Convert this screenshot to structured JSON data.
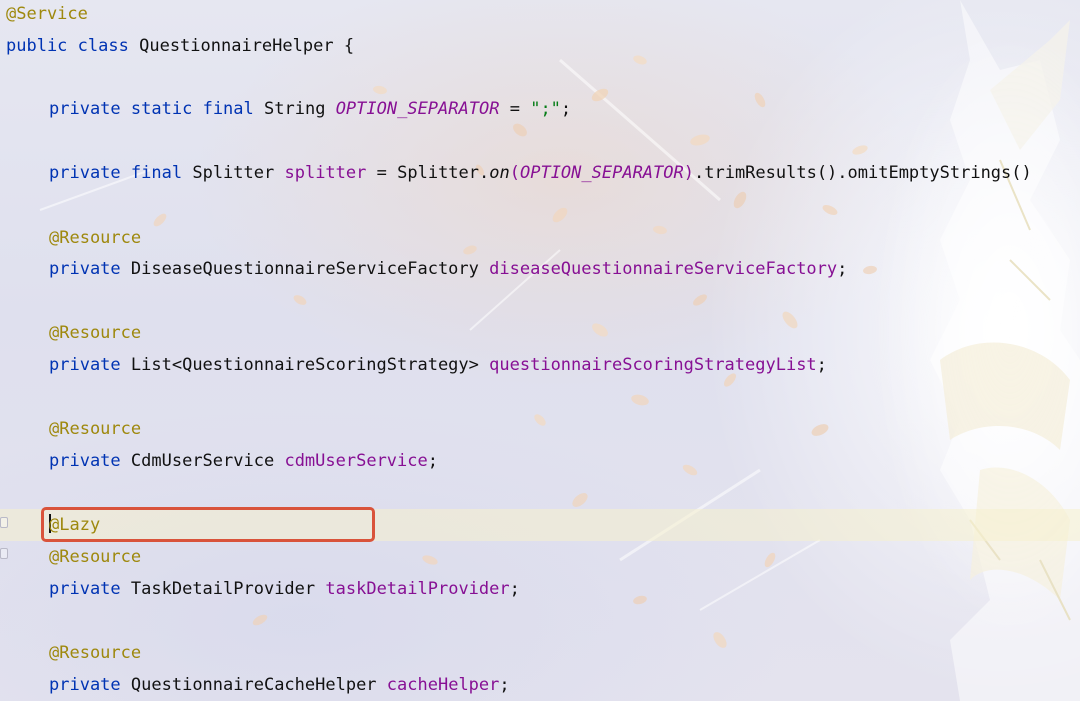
{
  "editor": {
    "lines": {
      "l1": {
        "annotation": "@Service"
      },
      "l2": {
        "kw1": "public",
        "kw2": "class",
        "class_name": "QuestionnaireHelper",
        "brace": "{"
      },
      "l3": {
        "kw1": "private",
        "kw2": "static",
        "kw3": "final",
        "type": "String",
        "const_name": "OPTION_SEPARATOR",
        "equals": "=",
        "string_value": "\";\"",
        "semicolon": ";"
      },
      "l4": {
        "kw1": "private",
        "kw2": "final",
        "type": "Splitter",
        "field": "splitter",
        "equals": "=",
        "receiver": "Splitter.",
        "method_on": "on",
        "paren_open": "(",
        "arg_const": "OPTION_SEPARATOR",
        "paren_close": ")",
        "chain": ".trimResults().omitEmptyStrings()"
      },
      "l5": {
        "annotation": "@Resource"
      },
      "l6": {
        "kw1": "private",
        "type": "DiseaseQuestionnaireServiceFactory",
        "field": "diseaseQuestionnaireServiceFactory",
        "semicolon": ";"
      },
      "l7": {
        "annotation": "@Resource"
      },
      "l8": {
        "kw1": "private",
        "type": "List<QuestionnaireScoringStrategy>",
        "field": "questionnaireScoringStrategyList",
        "semicolon": ";"
      },
      "l9": {
        "annotation": "@Resource"
      },
      "l10": {
        "kw1": "private",
        "type": "CdmUserService",
        "field": "cdmUserService",
        "semicolon": ";"
      },
      "l11": {
        "annotation": "@Lazy"
      },
      "l12": {
        "annotation": "@Resource"
      },
      "l13": {
        "kw1": "private",
        "type": "TaskDetailProvider",
        "field": "taskDetailProvider",
        "semicolon": ";"
      },
      "l14": {
        "annotation": "@Resource"
      },
      "l15": {
        "kw1": "private",
        "type": "QuestionnaireCacheHelper",
        "field": "cacheHelper",
        "semicolon": ";"
      }
    }
  },
  "colors": {
    "keyword": "#0033b3",
    "annotation": "#9e880d",
    "field": "#871094",
    "string": "#067d17",
    "highlight_border": "#d9533b"
  }
}
